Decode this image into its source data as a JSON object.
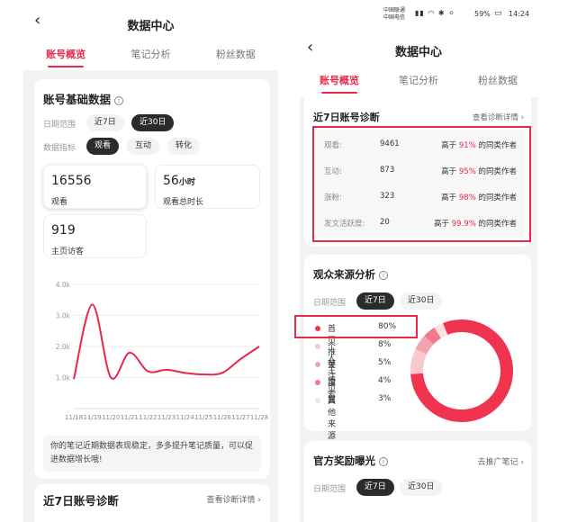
{
  "left": {
    "back": "‹",
    "title": "数据中心",
    "tabs": [
      "账号概览",
      "笔记分析",
      "粉丝数据"
    ],
    "basic": {
      "title": "账号基础数据",
      "date_label": "日期范围",
      "date_opts": [
        "近7日",
        "近30日"
      ],
      "metric_label": "数据指标",
      "metric_opts": [
        "观看",
        "互动",
        "转化"
      ],
      "stats": [
        {
          "value": "16556",
          "unit": "",
          "label": "观看"
        },
        {
          "value": "56",
          "unit": "小时",
          "label": "观看总时长"
        },
        {
          "value": "919",
          "unit": "",
          "label": "主页访客"
        }
      ]
    },
    "chart_data": {
      "type": "line",
      "y_ticks": [
        "4.0k",
        "3.0k",
        "2.0k",
        "1.0k"
      ],
      "ylim": [
        0,
        4000
      ],
      "categories": [
        "11/18",
        "11/19",
        "11/20",
        "11/21",
        "11/22",
        "11/23",
        "11/24",
        "11/25",
        "11/26",
        "11/27",
        "11/28"
      ],
      "values": [
        950,
        3350,
        1000,
        1800,
        1200,
        1250,
        1150,
        1100,
        1150,
        1600,
        2000
      ],
      "color": "#e8294c"
    },
    "note": "你的笔记近期数据表现稳定，多多提升笔记质量，可以促进数据增长哦!",
    "diag_title": "近7日账号诊断",
    "diag_link": "查看诊断详情 ›"
  },
  "right": {
    "status": {
      "carrier1": "中国联通",
      "carrier2": "中国电信",
      "battery": "59%",
      "time": "14:24"
    },
    "back": "‹",
    "title": "数据中心",
    "tabs": [
      "账号概览",
      "笔记分析",
      "粉丝数据"
    ],
    "diag": {
      "title": "近7日账号诊断",
      "link": "查看诊断详情 ›",
      "rows": [
        {
          "label": "观看:",
          "value": "9461",
          "prefix": "高于",
          "pct": "91%",
          "suffix": "的同类作者"
        },
        {
          "label": "互动:",
          "value": "873",
          "prefix": "高于",
          "pct": "95%",
          "suffix": "的同类作者"
        },
        {
          "label": "涨粉:",
          "value": "323",
          "prefix": "高于",
          "pct": "98%",
          "suffix": "的同类作者"
        },
        {
          "label": "发文活跃度:",
          "value": "20",
          "prefix": "高于",
          "pct": "99.9%",
          "suffix": "的同类作者"
        }
      ]
    },
    "source": {
      "title": "观众来源分析",
      "date_label": "日期范围",
      "date_opts": [
        "近7日",
        "近30日"
      ],
      "items": [
        {
          "name": "首页推荐",
          "pct": "80%",
          "value": 80,
          "color": "#f0344f"
        },
        {
          "name": "个人主页",
          "pct": "8%",
          "value": 8,
          "color": "#f9c9d0"
        },
        {
          "name": "关注页面",
          "pct": "5%",
          "value": 5,
          "color": "#f5a3b0"
        },
        {
          "name": "搜索",
          "pct": "4%",
          "value": 4,
          "color": "#f07a8c"
        },
        {
          "name": "其他来源",
          "pct": "3%",
          "value": 3,
          "color": "#fbe1e5"
        }
      ]
    },
    "reward": {
      "title": "官方奖励曝光",
      "link": "去推广笔记 ›",
      "date_label": "日期范围",
      "date_opts": [
        "近7日",
        "近30日"
      ]
    }
  }
}
